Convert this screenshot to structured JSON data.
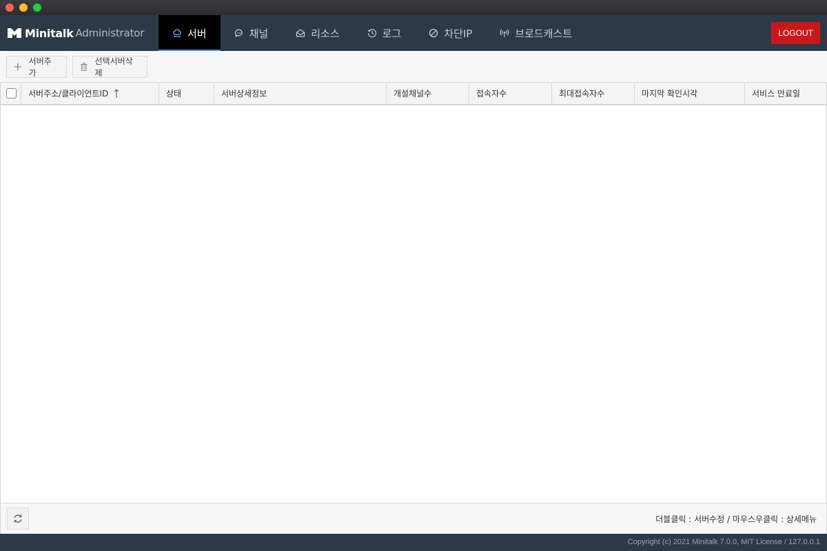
{
  "window": {
    "controls": [
      "close",
      "minimize",
      "maximize"
    ]
  },
  "brand": {
    "name": "Minitalk",
    "sub": "Administrator"
  },
  "nav": {
    "items": [
      {
        "label": "서버",
        "icon": "cloud-icon",
        "active": true
      },
      {
        "label": "채널",
        "icon": "chat-bubble-icon",
        "active": false
      },
      {
        "label": "리소스",
        "icon": "envelope-open-icon",
        "active": false
      },
      {
        "label": "로그",
        "icon": "history-icon",
        "active": false
      },
      {
        "label": "차단IP",
        "icon": "ban-icon",
        "active": false
      },
      {
        "label": "브로드캐스트",
        "icon": "broadcast-icon",
        "active": false
      }
    ],
    "logout_label": "LOGOUT"
  },
  "colors": {
    "header": "#2d3947",
    "active_tab": "#000000",
    "active_underline": "#3b9bdc",
    "logout": "#c9181b"
  },
  "toolbar": {
    "add_label": "서버추가",
    "delete_label": "선택서버삭제"
  },
  "grid": {
    "columns": [
      {
        "label": "서버주소/클라이언트ID",
        "sorted": "asc"
      },
      {
        "label": "상태"
      },
      {
        "label": "서버상세정보"
      },
      {
        "label": "개설채널수"
      },
      {
        "label": "접속자수"
      },
      {
        "label": "최대접속자수"
      },
      {
        "label": "마지막 확인시각"
      },
      {
        "label": "서비스 만료일"
      }
    ],
    "rows": []
  },
  "footer": {
    "hint": "더블클릭 : 서버수정 / 마우스우클릭 : 상세메뉴"
  },
  "status": {
    "copyright": "Copyright (c) 2021 Minitalk 7.0.0, MIT License / 127.0.0.1"
  }
}
